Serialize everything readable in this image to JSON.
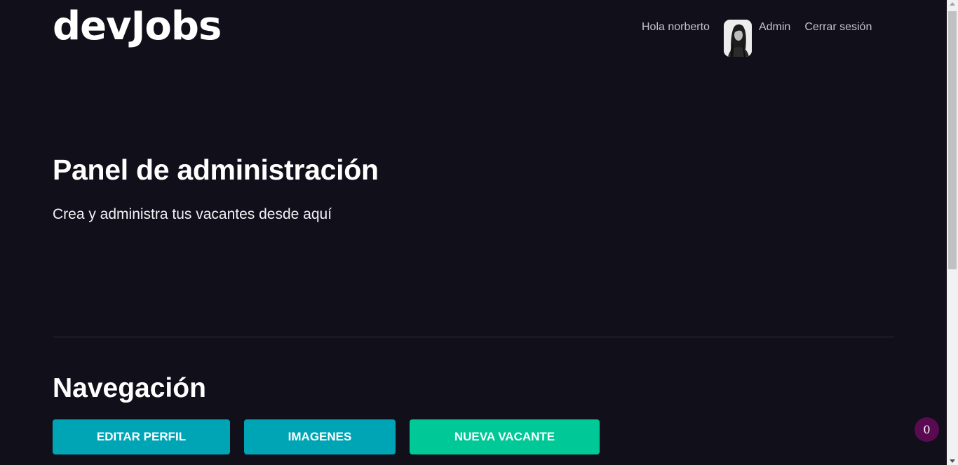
{
  "header": {
    "logo": "devJobs",
    "greeting": "Hola norberto",
    "admin_link": "Admin",
    "logout_link": "Cerrar sesión"
  },
  "hero": {
    "title": "Panel de administración",
    "subtitle": "Crea y administra tus vacantes desde aquí"
  },
  "navigation": {
    "title": "Navegación",
    "buttons": [
      {
        "label": "Editar Perfil"
      },
      {
        "label": "Imagenes"
      },
      {
        "label": "Nueva Vacante"
      }
    ]
  },
  "badge": {
    "count": "0"
  },
  "colors": {
    "background": "#11101a",
    "primary_button": "#00a5b5",
    "accent_button": "#00c896",
    "badge": "#5a0a50"
  },
  "icons": {
    "avatar": "user-avatar-photo"
  }
}
